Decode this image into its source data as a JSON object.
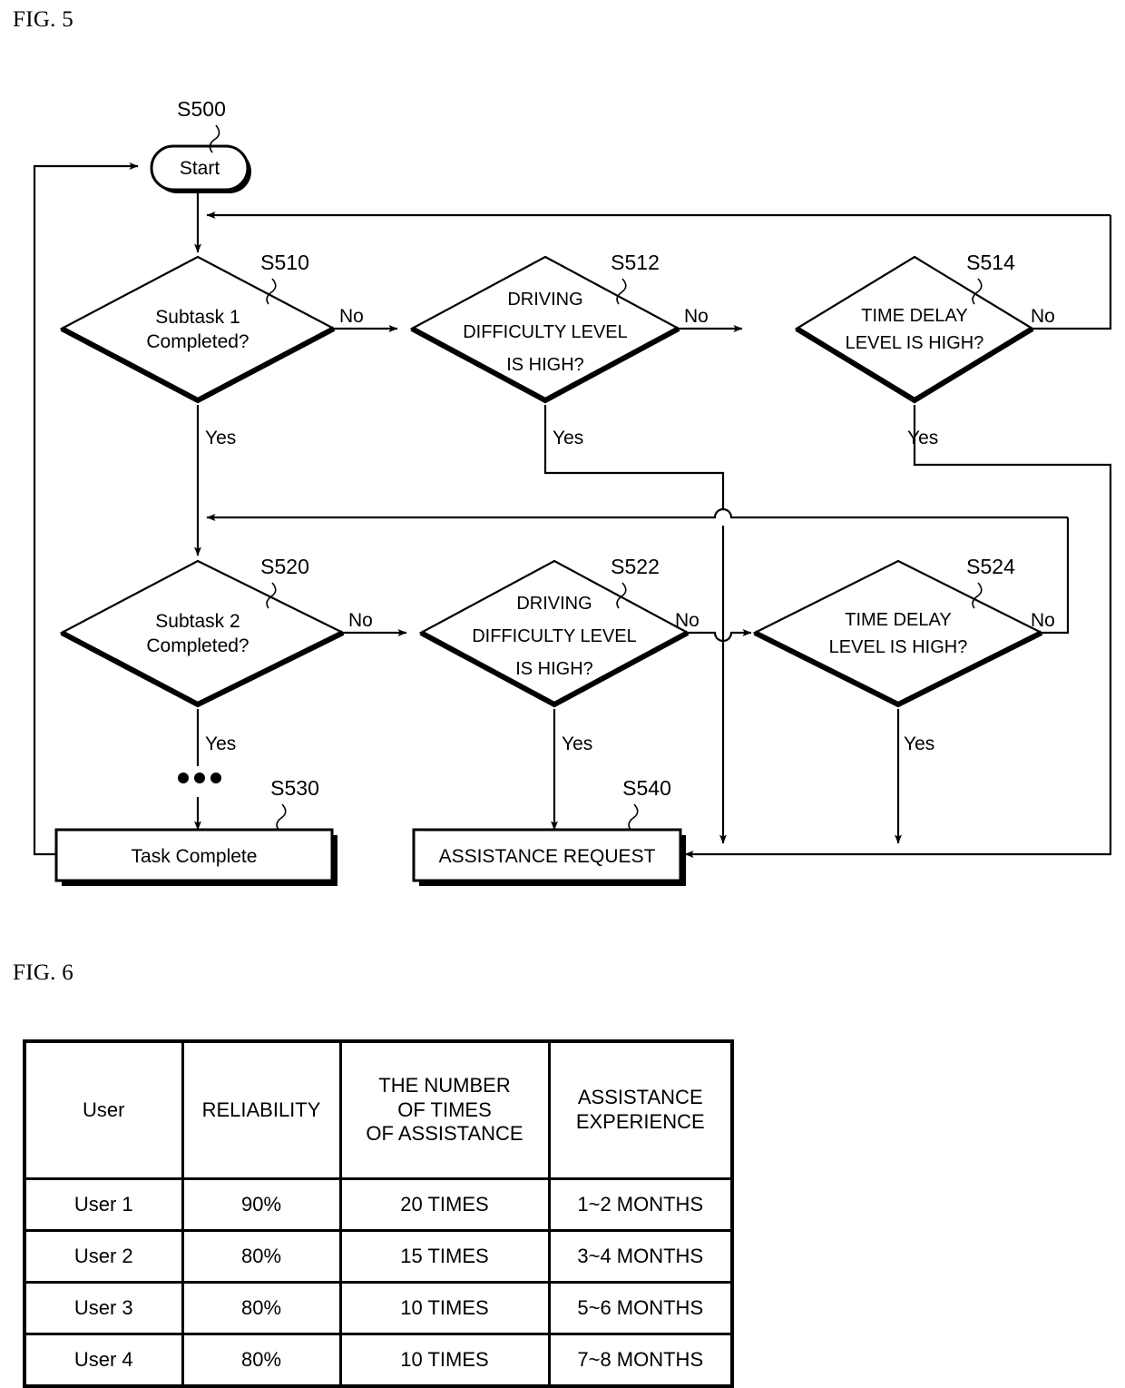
{
  "figures": {
    "fig5_label": "FIG. 5",
    "fig6_label": "FIG. 6"
  },
  "flowchart": {
    "start": {
      "ref": "S500",
      "label": "Start"
    },
    "decisions": [
      {
        "ref": "S510",
        "line1": "Subtask 1",
        "line2": "Completed?",
        "yes": "Yes",
        "no": "No"
      },
      {
        "ref": "S512",
        "line1": "DRIVING",
        "line2": "DIFFICULTY LEVEL",
        "line3": "IS HIGH?",
        "yes": "Yes",
        "no": "No"
      },
      {
        "ref": "S514",
        "line1": "TIME DELAY",
        "line2": "LEVEL IS HIGH?",
        "yes": "Yes",
        "no": "No"
      },
      {
        "ref": "S520",
        "line1": "Subtask 2",
        "line2": "Completed?",
        "yes": "Yes",
        "no": "No"
      },
      {
        "ref": "S522",
        "line1": "DRIVING",
        "line2": "DIFFICULTY LEVEL",
        "line3": "IS HIGH?",
        "yes": "Yes",
        "no": "No"
      },
      {
        "ref": "S524",
        "line1": "TIME DELAY",
        "line2": "LEVEL IS HIGH?",
        "yes": "Yes",
        "no": "No"
      }
    ],
    "terminals": [
      {
        "ref": "S530",
        "label": "Task Complete"
      },
      {
        "ref": "S540",
        "label": "ASSISTANCE REQUEST"
      }
    ],
    "ellipsis": "• • •",
    "colors": {
      "stroke": "#000000",
      "fill": "#ffffff"
    }
  },
  "table": {
    "headers": [
      {
        "lines": [
          "User"
        ]
      },
      {
        "lines": [
          "RELIABILITY"
        ]
      },
      {
        "lines": [
          "THE NUMBER",
          "OF TIMES",
          "OF ASSISTANCE"
        ]
      },
      {
        "lines": [
          "ASSISTANCE",
          "EXPERIENCE"
        ]
      }
    ],
    "rows": [
      [
        "User 1",
        "90%",
        "20 TIMES",
        "1~2 MONTHS"
      ],
      [
        "User 2",
        "80%",
        "15 TIMES",
        "3~4 MONTHS"
      ],
      [
        "User 3",
        "80%",
        "10 TIMES",
        "5~6 MONTHS"
      ],
      [
        "User 4",
        "80%",
        "10 TIMES",
        "7~8 MONTHS"
      ]
    ]
  }
}
